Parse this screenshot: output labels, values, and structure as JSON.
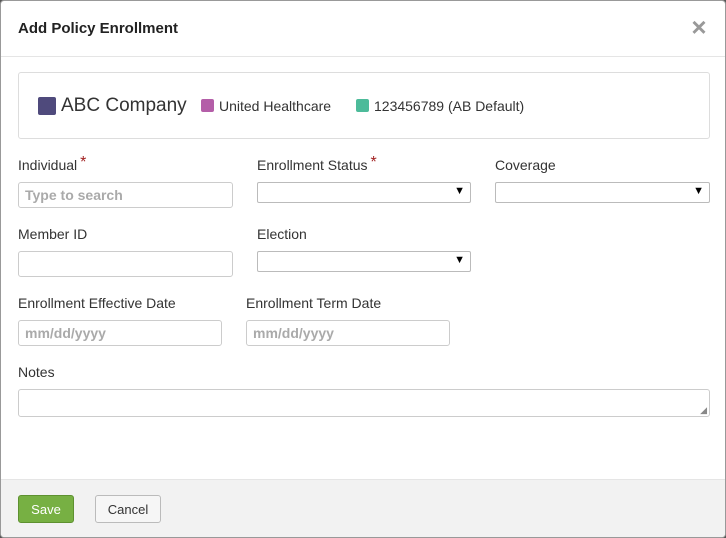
{
  "dialog": {
    "title": "Add Policy Enrollment",
    "close_glyph": "×"
  },
  "info": {
    "company": {
      "name": "ABC Company",
      "color": "#4f4a7c"
    },
    "carrier": {
      "name": "United Healthcare",
      "color": "#b45ea8"
    },
    "group": {
      "name": "123456789 (AB Default)",
      "color": "#4dbb9a"
    }
  },
  "form": {
    "individual": {
      "label": "Individual",
      "required_mark": "*",
      "placeholder": "Type to search",
      "value": ""
    },
    "enrollment_status": {
      "label": "Enrollment Status",
      "required_mark": "*",
      "value": ""
    },
    "coverage": {
      "label": "Coverage",
      "value": ""
    },
    "member_id": {
      "label": "Member ID",
      "value": ""
    },
    "election": {
      "label": "Election",
      "value": ""
    },
    "effective_date": {
      "label": "Enrollment Effective Date",
      "placeholder": "mm/dd/yyyy",
      "value": ""
    },
    "term_date": {
      "label": "Enrollment Term Date",
      "placeholder": "mm/dd/yyyy",
      "value": ""
    },
    "notes": {
      "label": "Notes",
      "value": ""
    }
  },
  "footer": {
    "save_label": "Save",
    "cancel_label": "Cancel"
  },
  "icons": {
    "select_arrow": "▼",
    "resize_grip": "◢"
  }
}
